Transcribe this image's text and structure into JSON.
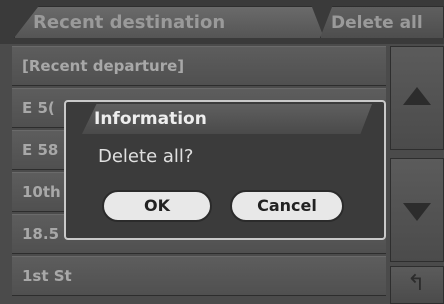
{
  "header": {
    "tab_recent_destination": "Recent destination",
    "tab_delete_all": "Delete all"
  },
  "list": {
    "items": [
      {
        "label": "[Recent departure]"
      },
      {
        "label": "E 5("
      },
      {
        "label": "E 58"
      },
      {
        "label": "10th"
      },
      {
        "label": "18.5"
      },
      {
        "label": "1st St"
      }
    ]
  },
  "controls": {
    "scroll_up_icon": "triangle-up-icon",
    "scroll_down_icon": "triangle-down-icon",
    "back_icon": "back-arrow-icon",
    "back_glyph": "↰"
  },
  "dialog": {
    "title": "Information",
    "message": "Delete all?",
    "ok_label": "OK",
    "cancel_label": "Cancel"
  }
}
